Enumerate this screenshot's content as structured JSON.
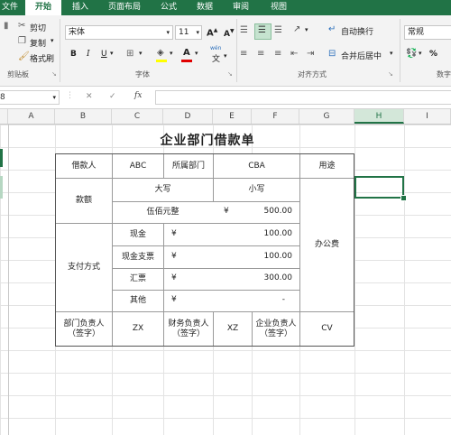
{
  "tabs": [
    "文件",
    "开始",
    "插入",
    "页面布局",
    "公式",
    "数据",
    "审阅",
    "视图"
  ],
  "clipboard": {
    "cut": "剪切",
    "copy": "复制",
    "painter": "格式刷",
    "group": "剪贴板"
  },
  "font": {
    "name": "宋体",
    "size": "11",
    "group": "字体",
    "bold": "B",
    "italic": "I",
    "underline": "U",
    "grow": "A",
    "shrink": "A",
    "phonetic": "wén",
    "phonetic_char": "文"
  },
  "align": {
    "wrap": "自动换行",
    "merge": "合并后居中",
    "group": "对齐方式"
  },
  "number": {
    "format": "常规",
    "group": "数字"
  },
  "formula": {
    "cancel": "✕",
    "enter": "✓",
    "fx": "fx"
  },
  "columns": [
    "A",
    "B",
    "C",
    "D",
    "E",
    "F",
    "G",
    "H",
    "I"
  ],
  "sheet": {
    "title": "企业部门借款单",
    "row1": {
      "borrower_label": "借款人",
      "borrower": "ABC",
      "dept_label": "所属部门",
      "dept": "CBA",
      "purpose_label": "用途"
    },
    "amount": {
      "label": "款额",
      "upper_label": "大写",
      "lower_label": "小写",
      "upper": "伍佰元整",
      "currency": "¥",
      "lower": "500.00"
    },
    "purpose_value": "办公费",
    "payment": {
      "label": "支付方式",
      "items": [
        {
          "name": "现金",
          "currency": "¥",
          "value": "100.00"
        },
        {
          "name": "现金支票",
          "currency": "¥",
          "value": "100.00"
        },
        {
          "name": "汇票",
          "currency": "¥",
          "value": "300.00"
        },
        {
          "name": "其他",
          "currency": "¥",
          "value": "-"
        }
      ]
    },
    "sign": {
      "dept_head_label": "部门负责人（签字）",
      "dept_head": "ZX",
      "finance_head_label": "财务负责人（签字）",
      "finance_head": "XZ",
      "company_head_label": "企业负责人（签字）",
      "company_head": "CV"
    }
  },
  "colors": {
    "accent": "#217346"
  }
}
